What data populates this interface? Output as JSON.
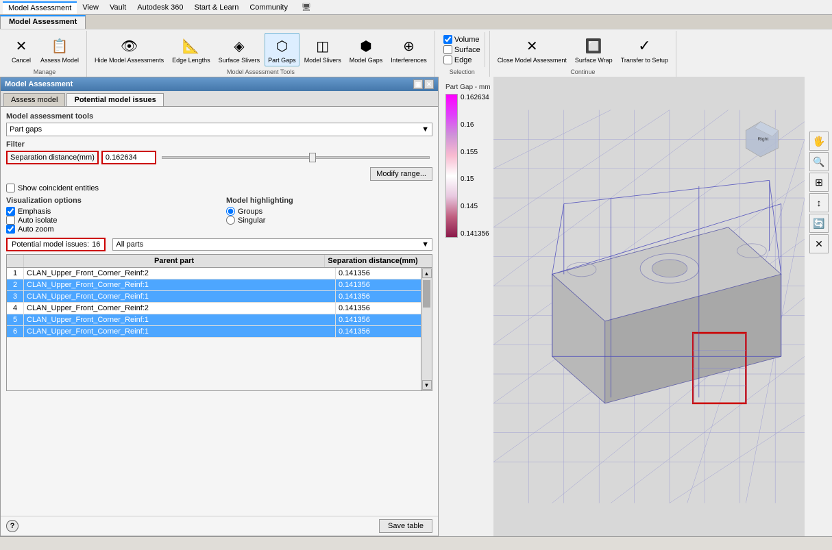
{
  "menubar": {
    "tabs": [
      "Model Assessment",
      "View",
      "Vault",
      "Autodesk 360",
      "Start & Learn",
      "Community"
    ]
  },
  "ribbon": {
    "active_tab": "Model Assessment",
    "groups": [
      {
        "name": "Manage",
        "buttons": [
          {
            "label": "Cancel",
            "icon": "✕"
          },
          {
            "label": "Assess Model",
            "icon": "📋"
          }
        ]
      },
      {
        "name": "Model Assessment Tools",
        "buttons": [
          {
            "label": "Hide Model Assessments",
            "icon": "👁"
          },
          {
            "label": "Edge Lengths",
            "icon": "📐"
          },
          {
            "label": "Surface Slivers",
            "icon": "◈"
          },
          {
            "label": "Part Gaps",
            "icon": "⬡"
          },
          {
            "label": "Model Slivers",
            "icon": "◫"
          },
          {
            "label": "Model Gaps",
            "icon": "⬢"
          },
          {
            "label": "Interferences",
            "icon": "⊕"
          }
        ]
      },
      {
        "name": "Selection",
        "items": [
          {
            "label": "Volume",
            "checked": true,
            "type": "checkbox"
          },
          {
            "label": "Surface",
            "checked": false,
            "type": "checkbox"
          },
          {
            "label": "Edge",
            "checked": false,
            "type": "checkbox"
          }
        ]
      },
      {
        "name": "Continue",
        "buttons": [
          {
            "label": "Close Model Assessment",
            "icon": "✕"
          },
          {
            "label": "Surface Wrap",
            "icon": "🔲"
          },
          {
            "label": "Transfer to Setup",
            "icon": "✓"
          }
        ]
      }
    ]
  },
  "left_panel": {
    "title": "Model Assessment",
    "tabs": [
      "Assess model",
      "Potential model issues"
    ],
    "active_tab": "Potential model issues",
    "model_assessment_tools_label": "Model assessment tools",
    "tools_dropdown": "Part gaps",
    "filter_section": {
      "label": "Filter",
      "separation_distance_label": "Separation distance(mm)",
      "separation_distance_value": "0.162634",
      "modify_range_btn": "Modify range...",
      "show_coincident_label": "Show coincident entities"
    },
    "visualization_options": {
      "label": "Visualization options",
      "emphasis_label": "Emphasis",
      "emphasis_checked": true,
      "auto_isolate_label": "Auto isolate",
      "auto_isolate_checked": false,
      "auto_zoom_label": "Auto zoom",
      "auto_zoom_checked": true
    },
    "model_highlighting": {
      "label": "Model highlighting",
      "groups_label": "Groups",
      "groups_selected": true,
      "singular_label": "Singular",
      "singular_selected": false
    },
    "issues_section": {
      "label": "Potential model issues:",
      "count": "16",
      "filter_dropdown": "All parts",
      "columns": [
        "Parent part",
        "Separation distance(mm)"
      ],
      "rows": [
        {
          "num": "1",
          "part": "CLAN_Upper_Front_Corner_Reinf:2",
          "sep": "0.141356",
          "selected": false
        },
        {
          "num": "2",
          "part": "CLAN_Upper_Front_Corner_Reinf:1",
          "sep": "0.141356",
          "selected": true
        },
        {
          "num": "3",
          "part": "CLAN_Upper_Front_Corner_Reinf:1",
          "sep": "0.141356",
          "selected": true
        },
        {
          "num": "4",
          "part": "CLAN_Upper_Front_Corner_Reinf:2",
          "sep": "0.141356",
          "selected": false
        },
        {
          "num": "5",
          "part": "CLAN_Upper_Front_Corner_Reinf:1",
          "sep": "0.141356",
          "selected": true
        },
        {
          "num": "6",
          "part": "CLAN_Upper_Front_Corner_Reinf:1",
          "sep": "0.141356",
          "selected": true
        }
      ]
    },
    "save_table_btn": "Save table",
    "help_btn": "?"
  },
  "legend": {
    "title": "Part Gap - mm",
    "max_value": "0.162634",
    "values": [
      "0.16",
      "0.155",
      "0.15",
      "0.145",
      "0.141356"
    ]
  },
  "nav_toolbar": {
    "buttons": [
      "🖐",
      "🔍",
      "⊕",
      "↕",
      "🔄",
      "✕"
    ]
  }
}
